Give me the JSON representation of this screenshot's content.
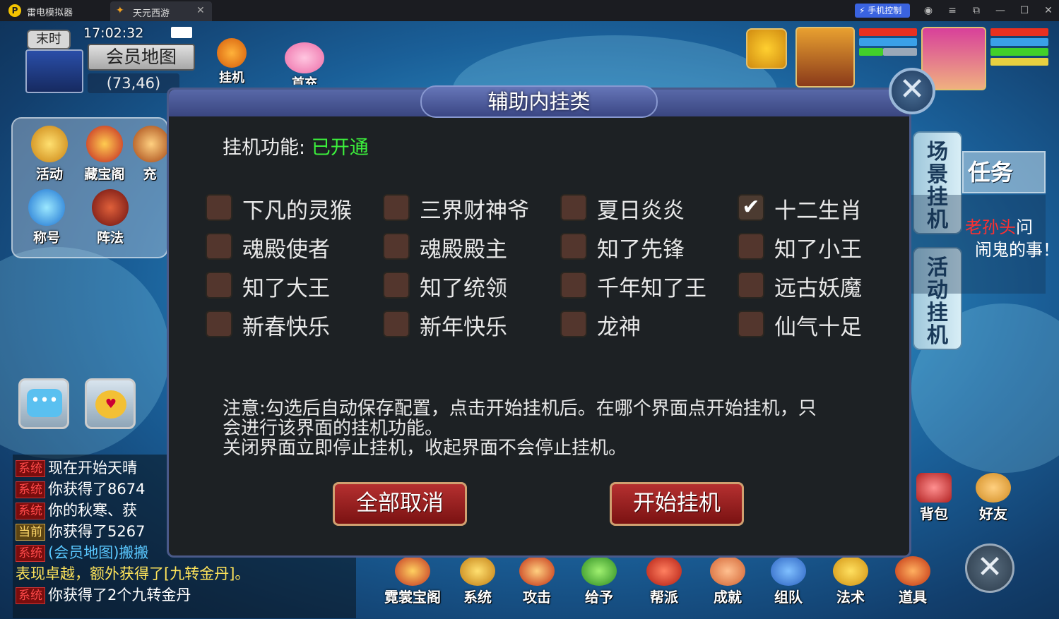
{
  "window": {
    "app_name": "雷电模拟器",
    "tab_title": "天元西游",
    "phone_control_label": "手机控制",
    "icons": [
      "account-icon",
      "menu-icon",
      "popout-icon",
      "minimize-icon",
      "maximize-icon",
      "close-icon"
    ]
  },
  "hud": {
    "time_of_day": "末时",
    "clock": "17:02:32",
    "map_name": "会员地图",
    "coords": "(73,46)",
    "top_icons": [
      {
        "label": "挂机",
        "icon": "robot-icon"
      },
      {
        "label": "首充",
        "icon": "winged-pet-icon"
      }
    ]
  },
  "left_menu": {
    "items": [
      {
        "label": "活动",
        "icon": "activity-icon"
      },
      {
        "label": "藏宝阁",
        "icon": "treasure-icon"
      },
      {
        "label": "充",
        "icon": "recharge-icon"
      },
      {
        "label": "称号",
        "icon": "title-icon"
      },
      {
        "label": "阵法",
        "icon": "formation-icon"
      }
    ]
  },
  "chat": {
    "lines": [
      {
        "tag": "系统",
        "text": "现在开始天晴"
      },
      {
        "tag": "系统",
        "text": "你获得了8674"
      },
      {
        "tag": "系统",
        "text": "你的秋寒、获"
      },
      {
        "tag": "当前",
        "text": "你获得了5267"
      },
      {
        "tag": "系统",
        "text": "(会员地图)搬搬"
      },
      {
        "tag": "",
        "text": "表现卓越，额外获得了[九转金丹]。"
      },
      {
        "tag": "系统",
        "text": "你获得了2个九转金丹"
      }
    ]
  },
  "right_panel": {
    "tabs": [
      "场景挂机",
      "活动挂机"
    ],
    "task_title": "任务",
    "task_text_1_red": "老孙头",
    "task_text_1_rest": "问",
    "task_text_2": "闹鬼的事！",
    "colors": {
      "hp": "#e83020",
      "mp": "#3aa0e8",
      "exp": "#42d02a"
    }
  },
  "bottom_bar": {
    "items": [
      {
        "label": "霓裳宝阁"
      },
      {
        "label": "系统"
      },
      {
        "label": "攻击"
      },
      {
        "label": "给予"
      },
      {
        "label": "帮派"
      },
      {
        "label": "成就"
      },
      {
        "label": "组队"
      },
      {
        "label": "法术"
      },
      {
        "label": "道具"
      },
      {
        "label": "背包"
      },
      {
        "label": "好友"
      }
    ]
  },
  "dialog": {
    "title": "辅助内挂类",
    "feature_label": "挂机功能:",
    "feature_status": "已开通",
    "options": [
      {
        "label": "下凡的灵猴",
        "checked": false
      },
      {
        "label": "三界财神爷",
        "checked": false
      },
      {
        "label": "夏日炎炎",
        "checked": false
      },
      {
        "label": "十二生肖",
        "checked": true
      },
      {
        "label": "魂殿使者",
        "checked": false
      },
      {
        "label": "魂殿殿主",
        "checked": false
      },
      {
        "label": "知了先锋",
        "checked": false
      },
      {
        "label": "知了小王",
        "checked": false
      },
      {
        "label": "知了大王",
        "checked": false
      },
      {
        "label": "知了统领",
        "checked": false
      },
      {
        "label": "千年知了王",
        "checked": false
      },
      {
        "label": "远古妖魔",
        "checked": false
      },
      {
        "label": "新春快乐",
        "checked": false
      },
      {
        "label": "新年快乐",
        "checked": false
      },
      {
        "label": "龙神",
        "checked": false
      },
      {
        "label": "仙气十足",
        "checked": false
      }
    ],
    "notice_line1": "注意:勾选后自动保存配置，点击开始挂机后。在哪个界面点开始挂机，只",
    "notice_line2": "会进行该界面的挂机功能。",
    "notice_line3": "关闭界面立即停止挂机，收起界面不会停止挂机。",
    "cancel_all_label": "全部取消",
    "start_label": "开始挂机"
  }
}
